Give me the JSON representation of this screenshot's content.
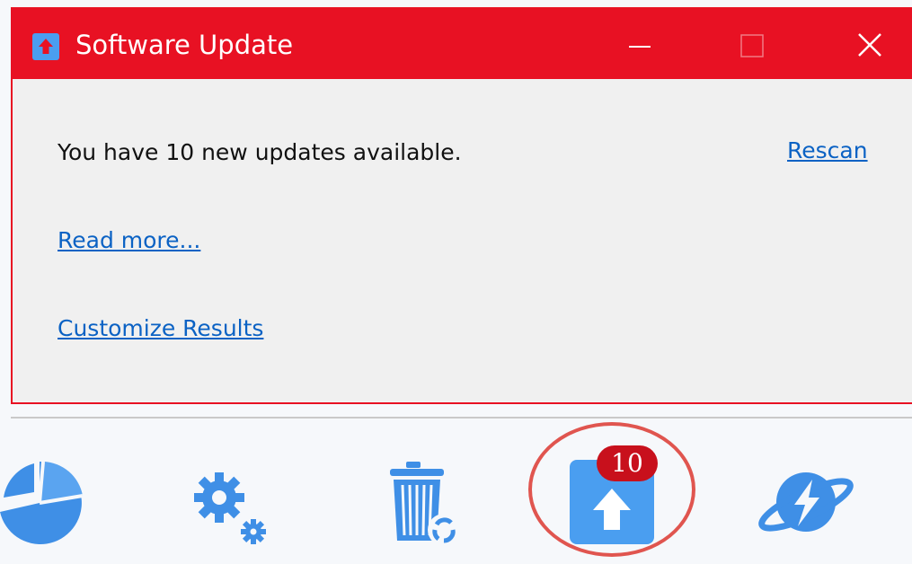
{
  "dialog": {
    "title": "Software Update",
    "icon": "update-arrow-icon",
    "controls": {
      "minimize": "minimize-icon",
      "maximize": "maximize-icon",
      "close": "close-icon"
    },
    "message": "You have 10 new updates available.",
    "rescan_label": "Rescan",
    "read_more_label": "Read more...",
    "customize_label": "Customize Results"
  },
  "toolbar": {
    "items": [
      {
        "name": "pie-chart-icon"
      },
      {
        "name": "gears-icon"
      },
      {
        "name": "recycle-trash-icon"
      },
      {
        "name": "software-update-icon",
        "badge": "10"
      },
      {
        "name": "turbo-planet-icon"
      }
    ]
  },
  "colors": {
    "title_bar": "#e81123",
    "accent_blue": "#4a9ef0",
    "link": "#0b62c4",
    "badge": "#c8101c",
    "highlight_ring": "#e0554f"
  }
}
